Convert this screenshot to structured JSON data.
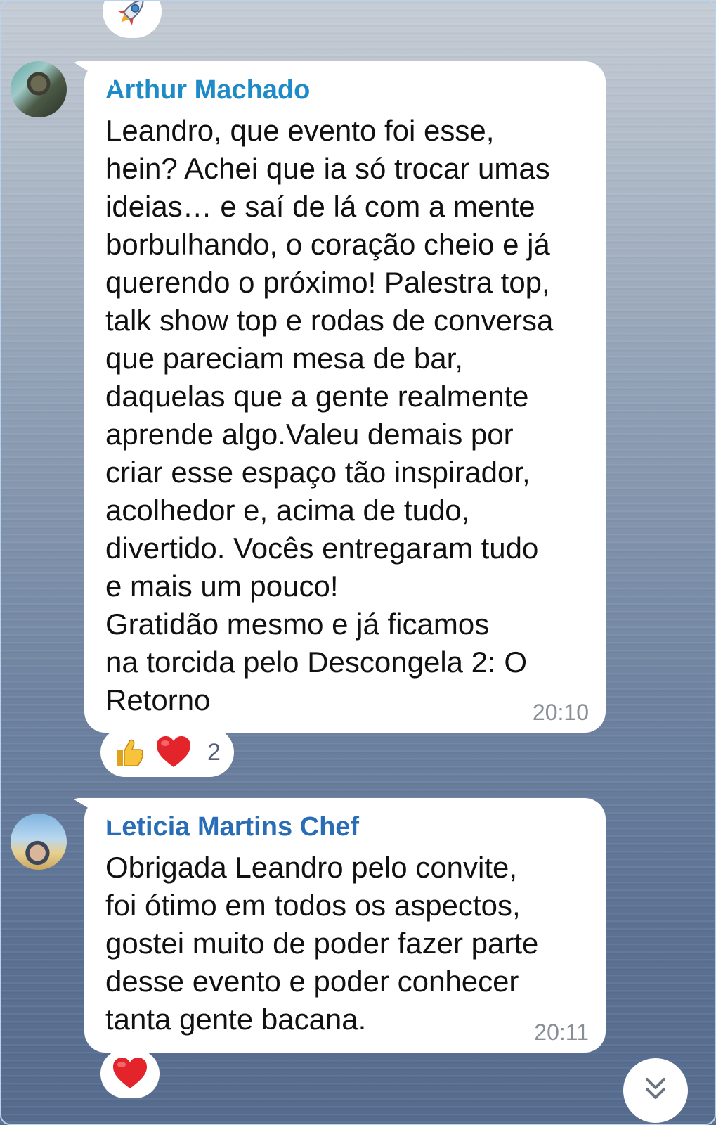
{
  "top_reaction": {
    "emoji": "rocket-icon"
  },
  "messages": [
    {
      "sender": "Arthur Machado",
      "text": "Leandro, que evento foi esse,\nhein? Achei que ia só trocar umas\nideias… e saí de lá com a mente\nborbulhando, o coração cheio e já\nquerendo o próximo! Palestra top,\ntalk show top e rodas de conversa\nque pareciam mesa de bar,\ndaquelas que a gente realmente\naprende algo.Valeu demais por\ncriar esse espaço tão inspirador,\nacolhedor e, acima de tudo,\ndivertido. Vocês entregaram tudo\ne mais um pouco!\nGratidão mesmo e já ficamos\nna torcida pelo Descongela 2: O\nRetorno",
      "time": "20:10",
      "reactions": [
        "thumbs-up-icon",
        "heart-icon"
      ],
      "reaction_count": "2"
    },
    {
      "sender": "Leticia Martins Chef",
      "text": "Obrigada Leandro pelo convite,\nfoi ótimo em todos os aspectos,\ngostei muito de poder fazer parte\ndesse evento e poder conhecer\ntanta gente bacana.",
      "time": "20:11",
      "reactions": [
        "heart-icon"
      ]
    }
  ],
  "colors": {
    "sender_1": "#1e8bc8",
    "sender_2": "#2a6db7",
    "bubble": "#ffffff",
    "time": "#8a8f96"
  }
}
